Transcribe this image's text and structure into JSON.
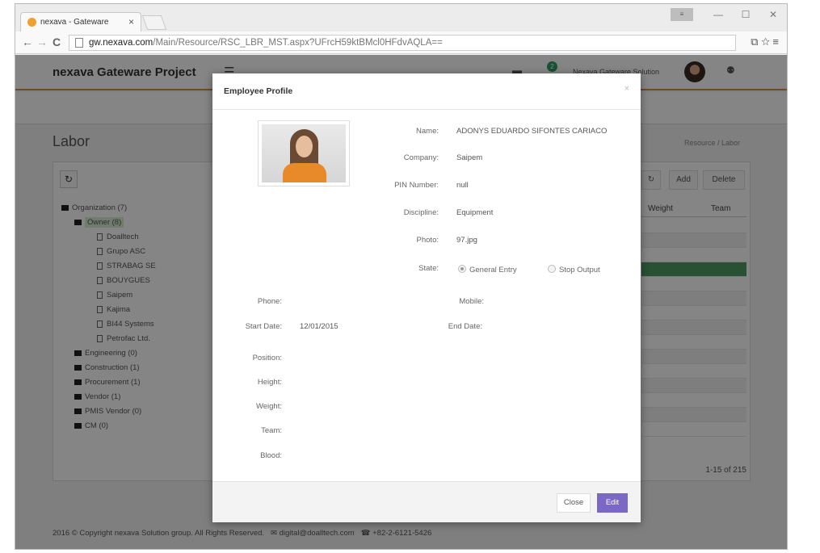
{
  "browser": {
    "tab_title": "nexava - Gateware",
    "tab_close": "×",
    "url_domain": "gw.nexava.com",
    "url_path": "/Main/Resource/RSC_LBR_MST.aspx?UFrcH59ktBMcl0HFdvAQLA==",
    "window_buttons": [
      "—",
      "☐",
      "✕"
    ]
  },
  "app": {
    "brand": "nexava Gateware Project",
    "header_user": "Nexava Gateware Solution",
    "notification_count": "2",
    "page_title": "Labor",
    "breadcrumb": "Resource / Labor",
    "tree": [
      {
        "label": "Organization (7)",
        "level": 0
      },
      {
        "label": "Owner (8)",
        "level": 1,
        "selected": true
      },
      {
        "label": "Doalltech",
        "level": 2
      },
      {
        "label": "Grupo ASC",
        "level": 2
      },
      {
        "label": "STRABAG SE",
        "level": 2
      },
      {
        "label": "BOUYGUES",
        "level": 2
      },
      {
        "label": "Saipem",
        "level": 2
      },
      {
        "label": "Kajima",
        "level": 2
      },
      {
        "label": "BI44 Systems",
        "level": 2
      },
      {
        "label": "Petrofac Ltd.",
        "level": 2
      },
      {
        "label": "Engineering (0)",
        "level": 1
      },
      {
        "label": "Construction (1)",
        "level": 1
      },
      {
        "label": "Procurement (1)",
        "level": 1
      },
      {
        "label": "Vendor (1)",
        "level": 1
      },
      {
        "label": "PMIS Vendor (0)",
        "level": 1
      },
      {
        "label": "CM (0)",
        "level": 1
      }
    ],
    "toolbar": {
      "add": "Add",
      "delete": "Delete"
    },
    "grid_columns": [
      "Weight",
      "Team"
    ],
    "pager": "1-15 of 215",
    "footer": {
      "copyright": "2016 © Copyright nexava Solution group. All Rights Reserved.",
      "email": "digital@doalltech.com",
      "phone": "+82-2-6121-5426"
    }
  },
  "modal": {
    "title": "Employee Profile",
    "close_x": "×",
    "fields": {
      "name_label": "Name:",
      "name_value": "ADONYS EDUARDO SIFONTES CARIACO",
      "company_label": "Company:",
      "company_value": "Saipem",
      "pin_label": "PIN Number:",
      "pin_value": "null",
      "discipline_label": "Discipline:",
      "discipline_value": "Equipment",
      "photo_label": "Photo:",
      "photo_value": "97.jpg",
      "state_label": "State:",
      "state_opt1": "General Entry",
      "state_opt2": "Stop Output",
      "phone_label": "Phone:",
      "mobile_label": "Mobile:",
      "start_label": "Start Date:",
      "start_value": "12/01/2015",
      "end_label": "End Date:",
      "position_label": "Position:",
      "height_label": "Height:",
      "weight_label": "Weight:",
      "team_label": "Team:",
      "blood_label": "Blood:"
    },
    "buttons": {
      "close": "Close",
      "edit": "Edit"
    }
  },
  "colors": {
    "accent": "#e08a3c",
    "edit_button": "#7b68c6",
    "selected_row": "#4f9a63"
  }
}
